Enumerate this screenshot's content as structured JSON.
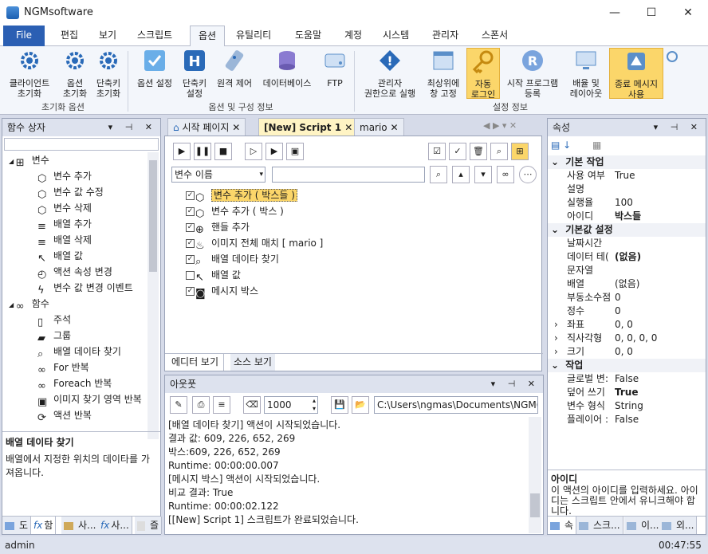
{
  "window": {
    "title": "NGMsoftware",
    "minimize": "—",
    "maximize": "☐",
    "close": "✕"
  },
  "ribbon_tabs": [
    "File",
    "편집",
    "보기",
    "스크립트",
    "옵션",
    "유틸리티",
    "도움말",
    "계정",
    "시스템",
    "관리자",
    "스폰서"
  ],
  "ribbon": {
    "groups": [
      {
        "label": "초기화 옵션",
        "buttons": [
          "클라이언트\n초기화",
          "옵션\n초기화",
          "단축키\n초기화"
        ]
      },
      {
        "label": "옵션 및 구성 정보",
        "buttons": [
          "옵션 설정",
          "단축키\n설정",
          "원격 제어",
          "데이터베이스",
          "FTP"
        ]
      },
      {
        "label": "설정 정보",
        "buttons": [
          "관리자\n권한으로 실행",
          "최상위에\n창 고정",
          "자동\n로그인",
          "시작 프로그램\n등록",
          "배율 및\n레이아웃",
          "종료 메시지\n사용"
        ]
      }
    ]
  },
  "left_panel": {
    "title": "함수 상자",
    "tree": [
      {
        "label": "변수",
        "level": 0,
        "icon": "variable-icon"
      },
      {
        "label": "변수 추가",
        "level": 1,
        "icon": "cube-icon"
      },
      {
        "label": "변수 값 수정",
        "level": 1,
        "icon": "cube-icon"
      },
      {
        "label": "변수 삭제",
        "level": 1,
        "icon": "cube-icon"
      },
      {
        "label": "배열 추가",
        "level": 1,
        "icon": "database-icon"
      },
      {
        "label": "배열 삭제",
        "level": 1,
        "icon": "database-icon"
      },
      {
        "label": "배열 값",
        "level": 1,
        "icon": "cursor-icon"
      },
      {
        "label": "액션 속성 변경",
        "level": 1,
        "icon": "clock-icon"
      },
      {
        "label": "변수 값 변경 이벤트",
        "level": 1,
        "icon": "bolt-icon"
      },
      {
        "label": "함수",
        "level": 0,
        "icon": "infinity-icon"
      },
      {
        "label": "주석",
        "level": 1,
        "icon": "comment-icon"
      },
      {
        "label": "그룹",
        "level": 1,
        "icon": "group-icon"
      },
      {
        "label": "배열 데이타 찾기",
        "level": 1,
        "icon": "search-icon"
      },
      {
        "label": "For 반복",
        "level": 1,
        "icon": "infinity-icon"
      },
      {
        "label": "Foreach 반복",
        "level": 1,
        "icon": "infinity-icon"
      },
      {
        "label": "이미지 찾기 영역 반복",
        "level": 1,
        "icon": "image-loop-icon"
      },
      {
        "label": "액션 반복",
        "level": 1,
        "icon": "loop-icon"
      }
    ],
    "desc_title": "배열 데이타 찾기",
    "desc_text": "배열에서 지정한 위치의 데이타를 가져옵니다.",
    "bottom_tabs": [
      "도",
      "함",
      "사...",
      "사...",
      "즐"
    ]
  },
  "doc_tabs": [
    "시작 페이지",
    "[New] Script 1",
    "mario"
  ],
  "editor": {
    "search_combo": "변수 이름",
    "search_value": "",
    "items": [
      {
        "label": "변수 추가 ( 박스들 )",
        "checked": true,
        "icon": "cube-icon",
        "selected": true
      },
      {
        "label": "변수 추가 ( 박스 )",
        "checked": true,
        "icon": "cube-icon"
      },
      {
        "label": "핸들 추가",
        "checked": true,
        "icon": "crosshair-icon"
      },
      {
        "label": "이미지 전체 매치 [ mario ]",
        "checked": true,
        "icon": "image-match-icon"
      },
      {
        "label": "배열 데이타 찾기",
        "checked": true,
        "icon": "search-icon"
      },
      {
        "label": "배열 값",
        "checked": false,
        "icon": "cursor-icon"
      },
      {
        "label": "메시지 박스",
        "checked": true,
        "icon": "message-icon"
      }
    ],
    "view_tabs": [
      "에디터 보기",
      "소스 보기"
    ]
  },
  "output": {
    "title": "아웃풋",
    "count": "1000",
    "path": "C:\\Users\\ngmas\\Documents\\NGM6\\",
    "lines": [
      "[배열 데이타 찾기] 액션이 시작되었습니다.",
      "결과 값: 609, 226, 652, 269",
      "박스:609, 226, 652, 269",
      "Runtime: 00:00:00.007",
      "[메시지 박스] 액션이 시작되었습니다.",
      "비교 결과: True",
      "Runtime: 00:00:02.122",
      "[[New] Script 1] 스크립트가 완료되었습니다."
    ]
  },
  "properties": {
    "title": "속성",
    "rows": [
      {
        "type": "cat",
        "name": "기본 작업"
      },
      {
        "type": "prop",
        "name": "사용 여부",
        "value": "True"
      },
      {
        "type": "prop",
        "name": "설명",
        "value": ""
      },
      {
        "type": "prop",
        "name": "실행율",
        "value": "100"
      },
      {
        "type": "prop",
        "name": "아이디",
        "value": "박스들",
        "bold": true
      },
      {
        "type": "cat",
        "name": "기본값 설정"
      },
      {
        "type": "prop",
        "name": "날짜시간",
        "value": ""
      },
      {
        "type": "prop",
        "name": "데이터 테(",
        "value": "(없음)",
        "bold": true
      },
      {
        "type": "prop",
        "name": "문자열",
        "value": ""
      },
      {
        "type": "prop",
        "name": "배열",
        "value": "(없음)"
      },
      {
        "type": "prop",
        "name": "부동소수점",
        "value": "0"
      },
      {
        "type": "prop",
        "name": "정수",
        "value": "0"
      },
      {
        "type": "prop",
        "name": "좌표",
        "value": "0, 0",
        "expand": true
      },
      {
        "type": "prop",
        "name": "직사각형",
        "value": "0, 0, 0, 0",
        "expand": true
      },
      {
        "type": "prop",
        "name": "크기",
        "value": "0, 0",
        "expand": true
      },
      {
        "type": "cat",
        "name": "작업"
      },
      {
        "type": "prop",
        "name": "글로벌 변:",
        "value": "False"
      },
      {
        "type": "prop",
        "name": "덮어 쓰기",
        "value": "True",
        "bold": true
      },
      {
        "type": "prop",
        "name": "변수 형식",
        "value": "String"
      },
      {
        "type": "prop",
        "name": "플레이어 :",
        "value": "False"
      }
    ],
    "desc_title": "아이디",
    "desc_text": "이 액션의 아이디를 입력하세요. 아이디는 스크립트 안에서 유니크해야 합니다.",
    "bottom_tabs": [
      "속",
      "스크...",
      "이...",
      "외..."
    ]
  },
  "status": {
    "user": "admin",
    "time": "00:47:55"
  },
  "colors": {
    "accent": "#2b5fb3",
    "highlight": "#fbd66a",
    "panel_header": "#dde2ee"
  }
}
